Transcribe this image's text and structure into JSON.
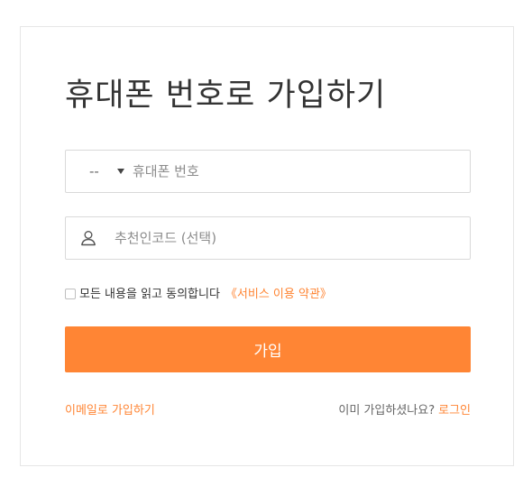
{
  "form": {
    "title": "휴대폰 번호로 가입하기",
    "country_code": "--",
    "phone_placeholder": "휴대폰 번호",
    "code_placeholder": "추천인코드 (선택)",
    "agree_text": "모든 내용을 읽고 동의합니다",
    "terms_link": "《서비스 이용 약관》",
    "agree_checked": false,
    "submit_label": "가입",
    "email_signup_link": "이메일로 가입하기",
    "already_member_text": "이미 가입하셨나요?",
    "login_link": "로그인"
  },
  "icons": {
    "country_dropdown": "caret-down-icon",
    "code_field": "user-icon"
  },
  "colors": {
    "accent": "#ff8534",
    "text": "#333333",
    "muted": "#8c8c8c",
    "border": "#d9d9d9"
  }
}
